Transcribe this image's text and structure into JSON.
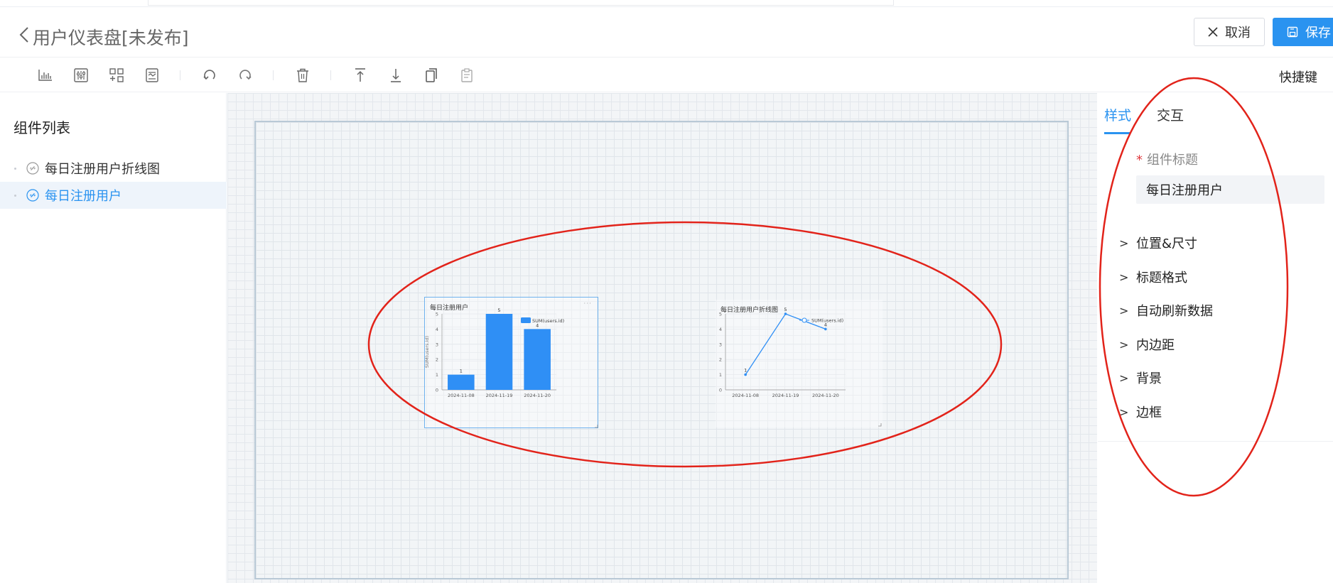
{
  "header": {
    "back_icon": "chevron-left-icon",
    "title": "用户仪表盘[未发布]",
    "cancel_label": "取消",
    "save_label": "保存"
  },
  "toolbar": {
    "tools": [
      "bar-chart-icon",
      "filter-control-icon",
      "layout-grid-icon",
      "report-icon",
      "undo-icon",
      "redo-icon",
      "delete-icon",
      "bring-to-front-icon",
      "send-to-back-icon",
      "copy-icon",
      "paste-icon"
    ],
    "shortcut_label": "快捷键"
  },
  "left_panel": {
    "title": "组件列表",
    "items": [
      {
        "label": "每日注册用户折线图",
        "selected": false
      },
      {
        "label": "每日注册用户",
        "selected": true
      }
    ]
  },
  "canvas": {
    "widgets": [
      {
        "title": "每日注册用户",
        "more": "···",
        "selected": true
      },
      {
        "title": "每日注册用户折线图",
        "selected": false
      }
    ]
  },
  "chart_data": [
    {
      "type": "bar",
      "title": "每日注册用户",
      "categories": [
        "2024-11-08",
        "2024-11-19",
        "2024-11-20"
      ],
      "series": [
        {
          "name": "SUM(users.id)",
          "values": [
            1,
            5,
            4
          ]
        }
      ],
      "ylabel": "SUM(users.id)",
      "ylim": [
        0,
        5
      ],
      "yticks": [
        0,
        1,
        2,
        3,
        4,
        5
      ],
      "data_labels": [
        "1",
        "5",
        "4"
      ],
      "legend": "top-right",
      "color": "#2f8ff5"
    },
    {
      "type": "line",
      "title": "每日注册用户折线图",
      "categories": [
        "2024-11-08",
        "2024-11-19",
        "2024-11-20"
      ],
      "series": [
        {
          "name": "SUM(users.id)",
          "values": [
            1,
            5,
            4
          ]
        }
      ],
      "ylabel": "SUM(users.id)",
      "ylim": [
        0,
        5
      ],
      "yticks": [
        0,
        1,
        2,
        3,
        4,
        5
      ],
      "data_labels": [
        "1",
        "5",
        "4"
      ],
      "legend": "top-right",
      "color": "#2f8ff5"
    }
  ],
  "right_panel": {
    "tabs": [
      "样式",
      "交互"
    ],
    "active_tab": "样式",
    "field_label": "组件标题",
    "required_mark": "*",
    "field_value": "每日注册用户",
    "sections": [
      "位置&尺寸",
      "标题格式",
      "自动刷新数据",
      "内边距",
      "背景",
      "边框"
    ]
  },
  "colors": {
    "primary": "#2a93f0",
    "annotation": "#e2231a"
  }
}
